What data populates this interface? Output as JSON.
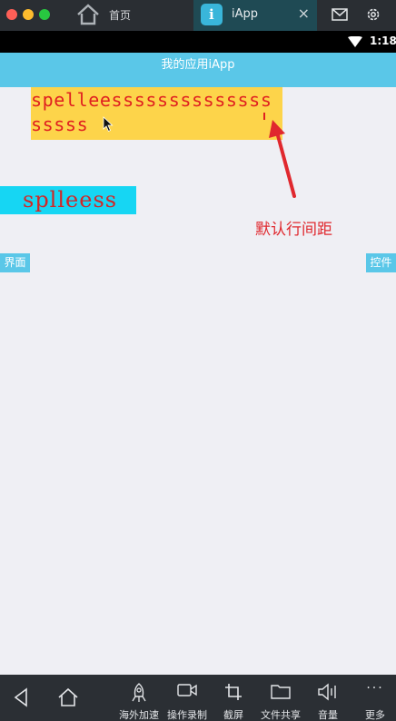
{
  "window": {
    "home_tab_label": "首页",
    "app_tab_label": "iApp",
    "app_badge_letter": "i",
    "close_symbol": "×",
    "icons": [
      "home-icon",
      "mail-icon",
      "gear-icon"
    ]
  },
  "status_bar": {
    "time": "1:18"
  },
  "app_bar": {
    "title": "我的应用iApp"
  },
  "content": {
    "yellow_text": "spelleesssssssssssssssssss",
    "cyan_text": "splleess",
    "annotation": "默认行间距",
    "left_button": "界面",
    "right_button": "控件",
    "colors": {
      "yellow": "#fdd44a",
      "cyan": "#16d6f3",
      "red_text": "#e02020",
      "accent": "#5ac7e8"
    }
  },
  "toolbar": {
    "items": [
      {
        "label": "海外加速",
        "icon": "rocket-icon"
      },
      {
        "label": "操作录制",
        "icon": "video-icon"
      },
      {
        "label": "截屏",
        "icon": "crop-icon"
      },
      {
        "label": "文件共享",
        "icon": "folder-icon"
      },
      {
        "label": "音量",
        "icon": "volume-icon"
      },
      {
        "label": "更多",
        "icon": "more-icon",
        "glyph": "···"
      }
    ]
  }
}
